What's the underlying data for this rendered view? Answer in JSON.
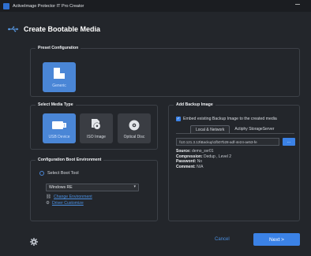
{
  "window": {
    "title": "ActiveImage Protector IT Pro Creator"
  },
  "header": {
    "title": "Create Bootable Media"
  },
  "preset": {
    "title": "Preset Configuration",
    "tiles": [
      {
        "label": "Generic",
        "icon": "generic-icon",
        "selected": true
      }
    ]
  },
  "media": {
    "title": "Select Media Type",
    "tiles": [
      {
        "label": "USB Device",
        "icon": "usb-drive-icon",
        "selected": true
      },
      {
        "label": "ISO Image",
        "icon": "iso-image-icon",
        "selected": false
      },
      {
        "label": "Optical Disc",
        "icon": "optical-disc-icon",
        "selected": false
      }
    ]
  },
  "boot": {
    "title": "Configuration Boot Environment",
    "radio_label": "Select Boot Tool",
    "select_value": "Windows RE",
    "links": [
      {
        "label": "Change Environment",
        "icon": "change-icon"
      },
      {
        "label": "Driver Customize",
        "icon": "driver-icon"
      }
    ]
  },
  "backup": {
    "title": "Add Backup Image",
    "checkbox_label": "Embed existing Backup Image to the created media",
    "checkbox_checked": true,
    "tabs": [
      "Local & Network",
      "Actiphy StorageServer"
    ],
    "path": "\\\\10.121.3.13\\Backup\\1fb07b28-adf-4e24-ae53-fe",
    "browse_label": "...",
    "info": [
      {
        "key": "Source:",
        "value": "demo_svr01"
      },
      {
        "key": "Compression:",
        "value": "Dedup , Level 2"
      },
      {
        "key": "Password:",
        "value": "No"
      },
      {
        "key": "Comment:",
        "value": "N/A"
      }
    ]
  },
  "footer": {
    "cancel": "Cancel",
    "next": "Next >"
  },
  "colors": {
    "accent": "#3b82e6",
    "background": "#23262b",
    "link": "#4a8fe0"
  }
}
